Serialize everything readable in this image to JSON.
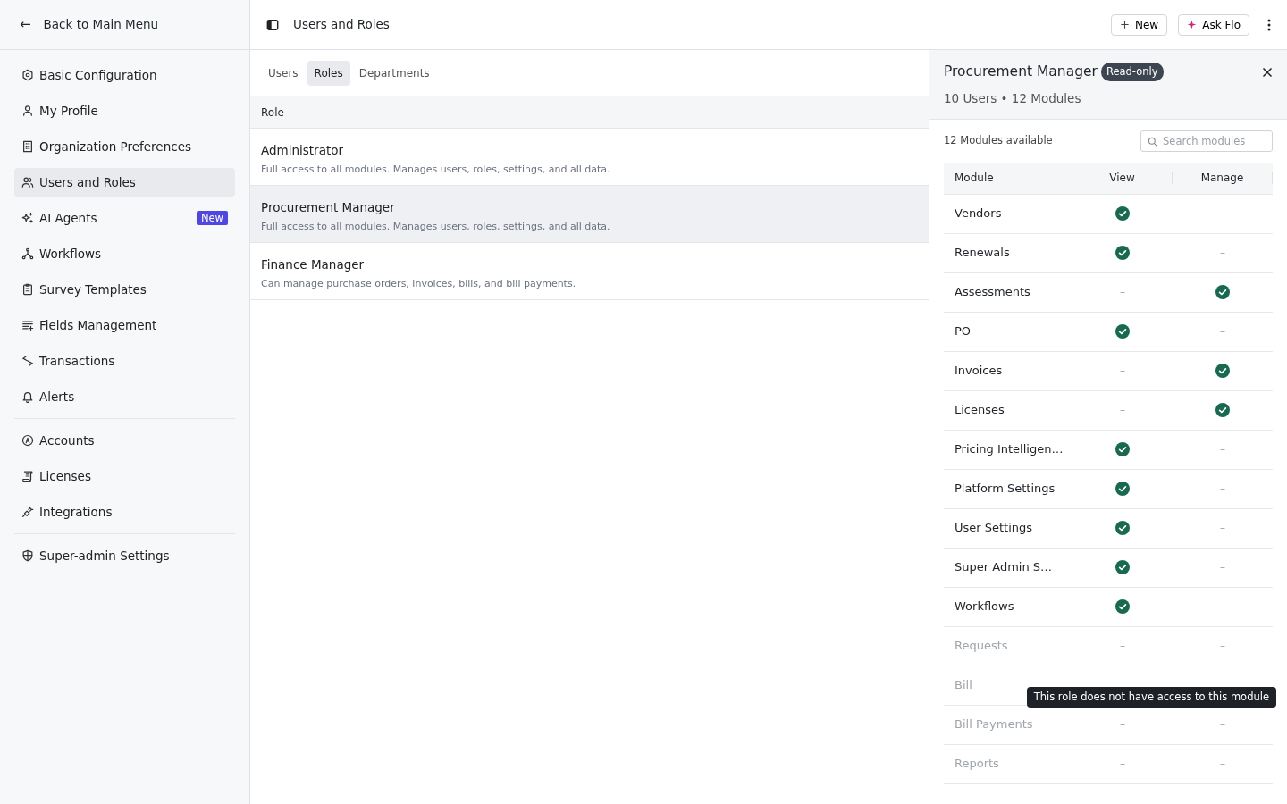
{
  "sidebar": {
    "back": {
      "arrow": "←",
      "label": "Back to Main Menu"
    },
    "groups": [
      [
        {
          "label": "Basic Configuration",
          "selected": false
        },
        {
          "label": "My Profile",
          "selected": false
        },
        {
          "label": "Organization Preferences",
          "selected": false
        },
        {
          "label": "Users and Roles",
          "selected": true
        },
        {
          "label": "AI Agents",
          "selected": false,
          "badge": "New"
        },
        {
          "label": "Workflows",
          "selected": false
        },
        {
          "label": "Survey Templates",
          "selected": false
        },
        {
          "label": "Fields Management",
          "selected": false
        },
        {
          "label": "Transactions",
          "selected": false
        },
        {
          "label": "Alerts",
          "selected": false
        }
      ],
      [
        {
          "label": "Accounts",
          "selected": false
        },
        {
          "label": "Licenses",
          "selected": false
        },
        {
          "label": "Integrations",
          "selected": false
        }
      ],
      [
        {
          "label": "Super-admin Settings",
          "selected": false
        }
      ]
    ]
  },
  "header": {
    "title": "Users and Roles",
    "new_button": "New",
    "ask_button": "Ask Flo"
  },
  "tabs": [
    {
      "label": "Users",
      "selected": false
    },
    {
      "label": "Roles",
      "selected": true
    },
    {
      "label": "Departments",
      "selected": false
    }
  ],
  "roles_table": {
    "column": "Role",
    "rows": [
      {
        "name": "Administrator",
        "description": "Full access to all modules. Manages users, roles, settings, and all data.",
        "selected": false
      },
      {
        "name": "Procurement Manager",
        "description": "Full access to all modules. Manages users, roles, settings, and all data.",
        "selected": true
      },
      {
        "name": "Finance Manager",
        "description": "Can manage purchase orders, invoices, bills, and bill payments.",
        "selected": false
      }
    ]
  },
  "detail": {
    "title": "Procurement Manager",
    "badge": "Read-only",
    "summary": "10 Users • 12 Modules",
    "available": "12 Modules available",
    "search": {
      "placeholder": "Search modules"
    },
    "columns": [
      "Module",
      "View",
      "Manage"
    ],
    "modules": [
      {
        "name": "Vendors",
        "disabled": false,
        "view": {
          "checked": true
        },
        "manage": {
          "checked": false,
          "text": "–"
        }
      },
      {
        "name": "Renewals",
        "disabled": false,
        "view": {
          "checked": true
        },
        "manage": {
          "checked": false,
          "text": "–"
        }
      },
      {
        "name": "Assessments",
        "disabled": false,
        "view": {
          "checked": false,
          "text": "–"
        },
        "manage": {
          "checked": true
        }
      },
      {
        "name": "PO",
        "disabled": false,
        "view": {
          "checked": true
        },
        "manage": {
          "checked": false,
          "text": "–"
        }
      },
      {
        "name": "Invoices",
        "disabled": false,
        "view": {
          "checked": false,
          "text": "–"
        },
        "manage": {
          "checked": true
        }
      },
      {
        "name": "Licenses",
        "disabled": false,
        "view": {
          "checked": false,
          "text": "–"
        },
        "manage": {
          "checked": true
        }
      },
      {
        "name": "Pricing Intelligen…",
        "disabled": false,
        "view": {
          "checked": true
        },
        "manage": {
          "checked": false,
          "text": "–"
        }
      },
      {
        "name": "Platform Settings",
        "disabled": false,
        "view": {
          "checked": true
        },
        "manage": {
          "checked": false,
          "text": "–"
        }
      },
      {
        "name": "User Settings",
        "disabled": false,
        "view": {
          "checked": true
        },
        "manage": {
          "checked": false,
          "text": "–"
        }
      },
      {
        "name": "Super Admin S…",
        "disabled": false,
        "view": {
          "checked": true
        },
        "manage": {
          "checked": false,
          "text": "–"
        }
      },
      {
        "name": "Workflows",
        "disabled": false,
        "view": {
          "checked": true
        },
        "manage": {
          "checked": false,
          "text": "–"
        }
      },
      {
        "name": "Requests",
        "disabled": true,
        "view": {
          "checked": false,
          "text": "–"
        },
        "manage": {
          "checked": false,
          "text": "–"
        }
      },
      {
        "name": "Bill",
        "disabled": true,
        "view": {
          "checked": false
        },
        "manage": {
          "checked": false
        },
        "tooltip": "This role does not have access to this module"
      },
      {
        "name": "Bill Payments",
        "disabled": true,
        "view": {
          "checked": false,
          "text": "–"
        },
        "manage": {
          "checked": false,
          "text": "–"
        }
      },
      {
        "name": "Reports",
        "disabled": true,
        "view": {
          "checked": false,
          "text": "–"
        },
        "manage": {
          "checked": false,
          "text": "–"
        }
      }
    ]
  }
}
